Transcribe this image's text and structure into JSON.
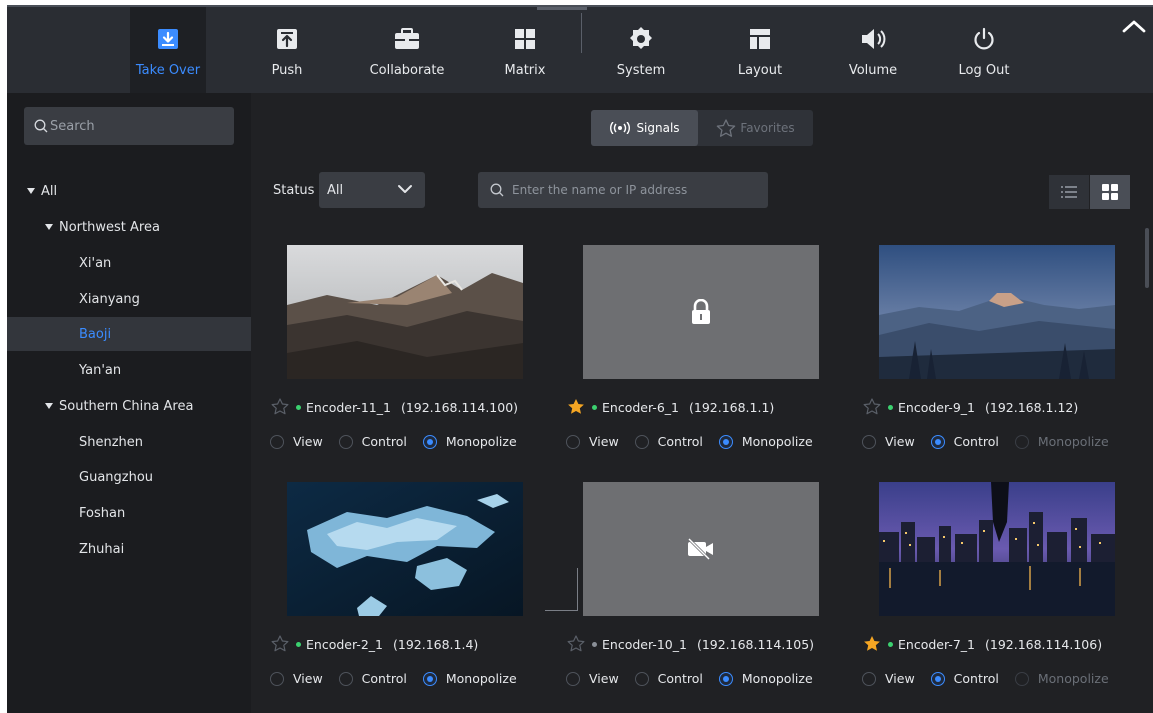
{
  "toolbar": {
    "items": [
      {
        "label": "Take Over",
        "icon": "download-icon"
      },
      {
        "label": "Push",
        "icon": "upload-icon"
      },
      {
        "label": "Collaborate",
        "icon": "briefcase-icon"
      },
      {
        "label": "Matrix",
        "icon": "grid-icon"
      },
      {
        "label": "System",
        "icon": "gear-icon"
      },
      {
        "label": "Layout",
        "icon": "layout-icon"
      },
      {
        "label": "Volume",
        "icon": "speaker-icon"
      },
      {
        "label": "Log Out",
        "icon": "power-icon"
      }
    ],
    "active": "Take Over",
    "accent_color": "#3b8cff"
  },
  "sidebar": {
    "search_placeholder": "Search",
    "tree": [
      {
        "label": "All",
        "expandable": true
      },
      {
        "label": "Northwest Area",
        "expandable": true
      },
      {
        "label": "Xi'an"
      },
      {
        "label": "Xianyang"
      },
      {
        "label": "Baoji",
        "selected": true
      },
      {
        "label": "Yan'an"
      },
      {
        "label": "Southern China Area",
        "expandable": true
      },
      {
        "label": "Shenzhen"
      },
      {
        "label": "Guangzhou"
      },
      {
        "label": "Foshan"
      },
      {
        "label": "Zhuhai"
      }
    ]
  },
  "main": {
    "tabs": {
      "signals": "Signals",
      "favorites": "Favorites",
      "active": "Signals"
    },
    "status_label": "Status",
    "status_value": "All",
    "filter_placeholder": "Enter the name or IP address",
    "view_mode": "grid",
    "options": {
      "view": "View",
      "control": "Control",
      "monopolize": "Monopolize"
    },
    "cards": [
      {
        "name": "Encoder-11_1",
        "ip": "(192.168.114.100)",
        "favorite": false,
        "online": true,
        "thumbnail": "mountain-ridge",
        "selected": "monopolize",
        "monopolize_disabled": false
      },
      {
        "name": "Encoder-6_1",
        "ip": "(192.168.1.1)",
        "favorite": true,
        "online": true,
        "thumbnail": "lock-icon",
        "selected": "monopolize",
        "monopolize_disabled": false
      },
      {
        "name": "Encoder-9_1",
        "ip": "(192.168.1.12)",
        "favorite": false,
        "online": true,
        "thumbnail": "half-dome",
        "selected": "control",
        "monopolize_disabled": true
      },
      {
        "name": "Encoder-2_1",
        "ip": "(192.168.1.4)",
        "favorite": false,
        "online": true,
        "thumbnail": "ice-floes",
        "selected": "monopolize",
        "monopolize_disabled": false
      },
      {
        "name": "Encoder-10_1",
        "ip": "(192.168.114.105)",
        "favorite": false,
        "online": false,
        "thumbnail": "video-off-icon",
        "selected": "monopolize",
        "monopolize_disabled": false
      },
      {
        "name": "Encoder-7_1",
        "ip": "(192.168.114.106)",
        "favorite": true,
        "online": true,
        "thumbnail": "city-night",
        "selected": "control",
        "monopolize_disabled": true
      }
    ]
  }
}
